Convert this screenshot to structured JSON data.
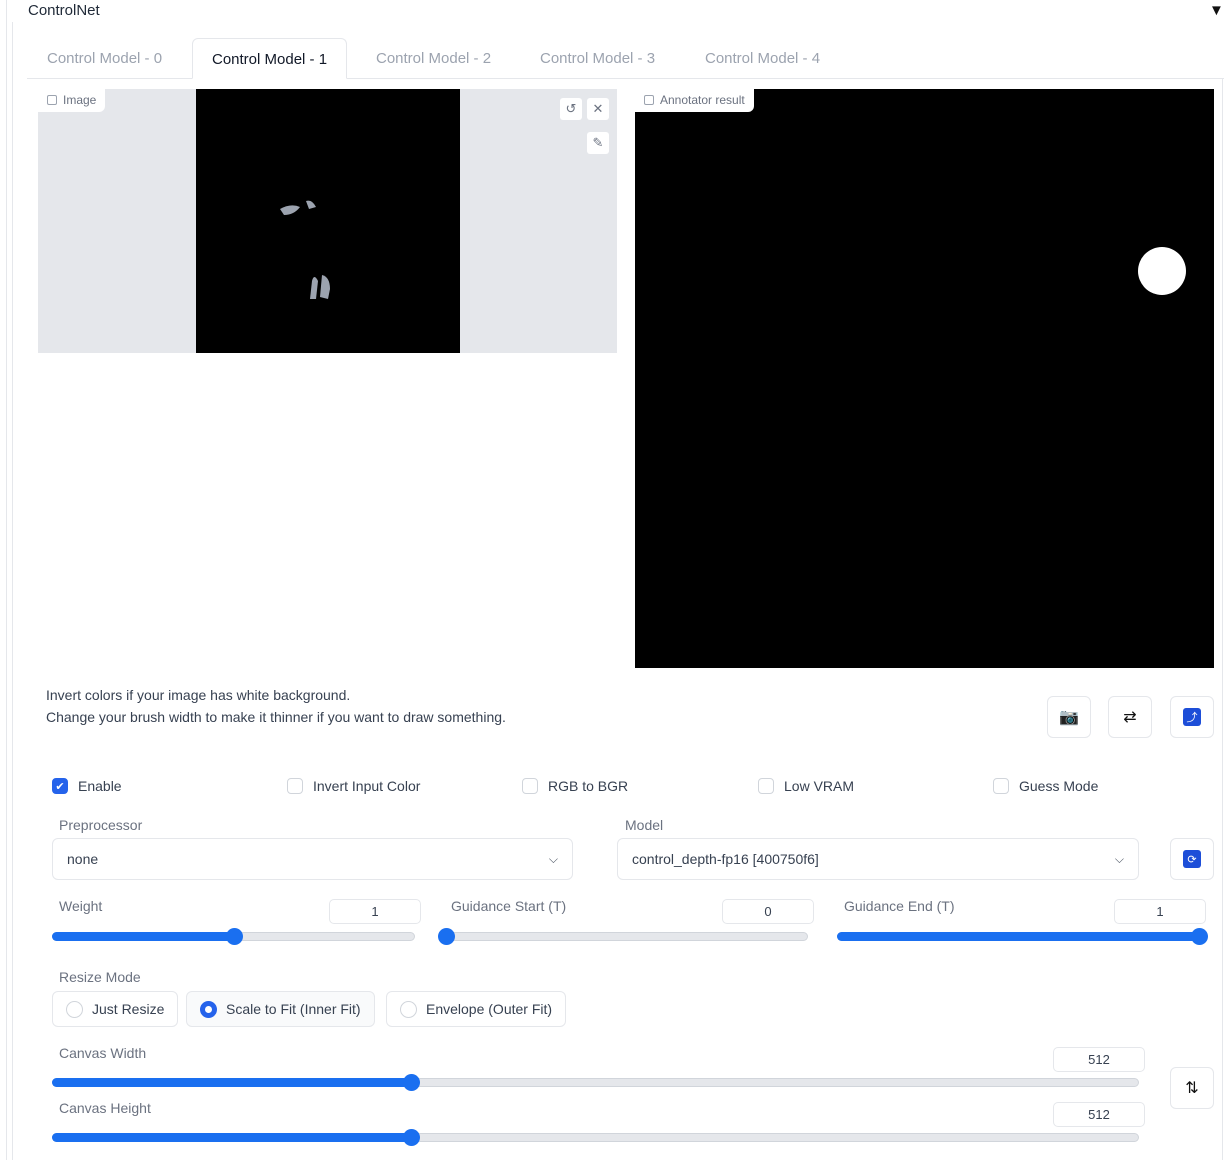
{
  "header": {
    "title": "ControlNet",
    "collapse_icon": "triangle-down-icon"
  },
  "tabs": [
    {
      "label": "Control Model - 0",
      "active": false
    },
    {
      "label": "Control Model - 1",
      "active": true
    },
    {
      "label": "Control Model - 2",
      "active": false
    },
    {
      "label": "Control Model - 3",
      "active": false
    },
    {
      "label": "Control Model - 4",
      "active": false
    }
  ],
  "image_panel": {
    "label": "Image",
    "tools": [
      "undo-icon",
      "close-icon",
      "brush-icon"
    ]
  },
  "annotator_panel": {
    "label": "Annotator result"
  },
  "hints": [
    "Invert colors if your image has white background.",
    "Change your brush width to make it thinner if you want to draw something."
  ],
  "actions": [
    "camera-icon",
    "swap-icon",
    "upload-icon"
  ],
  "checkboxes": [
    {
      "label": "Enable",
      "checked": true
    },
    {
      "label": "Invert Input Color",
      "checked": false
    },
    {
      "label": "RGB to BGR",
      "checked": false
    },
    {
      "label": "Low VRAM",
      "checked": false
    },
    {
      "label": "Guess Mode",
      "checked": false
    }
  ],
  "preprocessor": {
    "label": "Preprocessor",
    "value": "none"
  },
  "model": {
    "label": "Model",
    "value": "control_depth-fp16 [400750f6]",
    "refresh_icon": "refresh-icon"
  },
  "sliders": {
    "weight": {
      "label": "Weight",
      "value": "1",
      "fraction": 0.5
    },
    "guidance_start": {
      "label": "Guidance Start (T)",
      "value": "0",
      "fraction": 0.0
    },
    "guidance_end": {
      "label": "Guidance End (T)",
      "value": "1",
      "fraction": 1.0
    },
    "canvas_width": {
      "label": "Canvas Width",
      "value": "512",
      "fraction": 0.33
    },
    "canvas_height": {
      "label": "Canvas Height",
      "value": "512",
      "fraction": 0.33
    }
  },
  "resize_mode": {
    "label": "Resize Mode",
    "options": [
      {
        "label": "Just Resize",
        "selected": false
      },
      {
        "label": "Scale to Fit (Inner Fit)",
        "selected": true
      },
      {
        "label": "Envelope (Outer Fit)",
        "selected": false
      }
    ]
  },
  "swap_dims_icon": "swap-vertical-icon",
  "colors": {
    "accent": "#1a6ff0",
    "checkbox": "#2563eb",
    "panel_bg": "#e5e7eb"
  }
}
